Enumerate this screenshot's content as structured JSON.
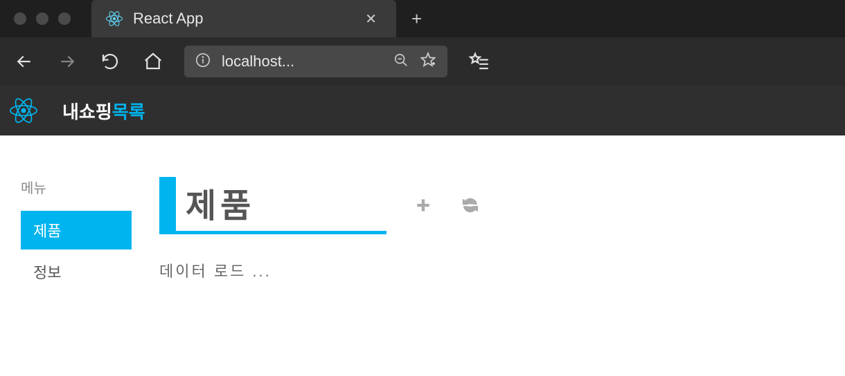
{
  "browser": {
    "tab_title": "React App",
    "url_display": "localhost..."
  },
  "app": {
    "title_part1": "내쇼핑",
    "title_part2": "목록"
  },
  "sidebar": {
    "label": "메뉴",
    "items": [
      {
        "label": "제품",
        "active": true
      },
      {
        "label": "정보",
        "active": false
      }
    ]
  },
  "main": {
    "page_title": "제품",
    "loading_text": "데이터 로드  ..."
  }
}
